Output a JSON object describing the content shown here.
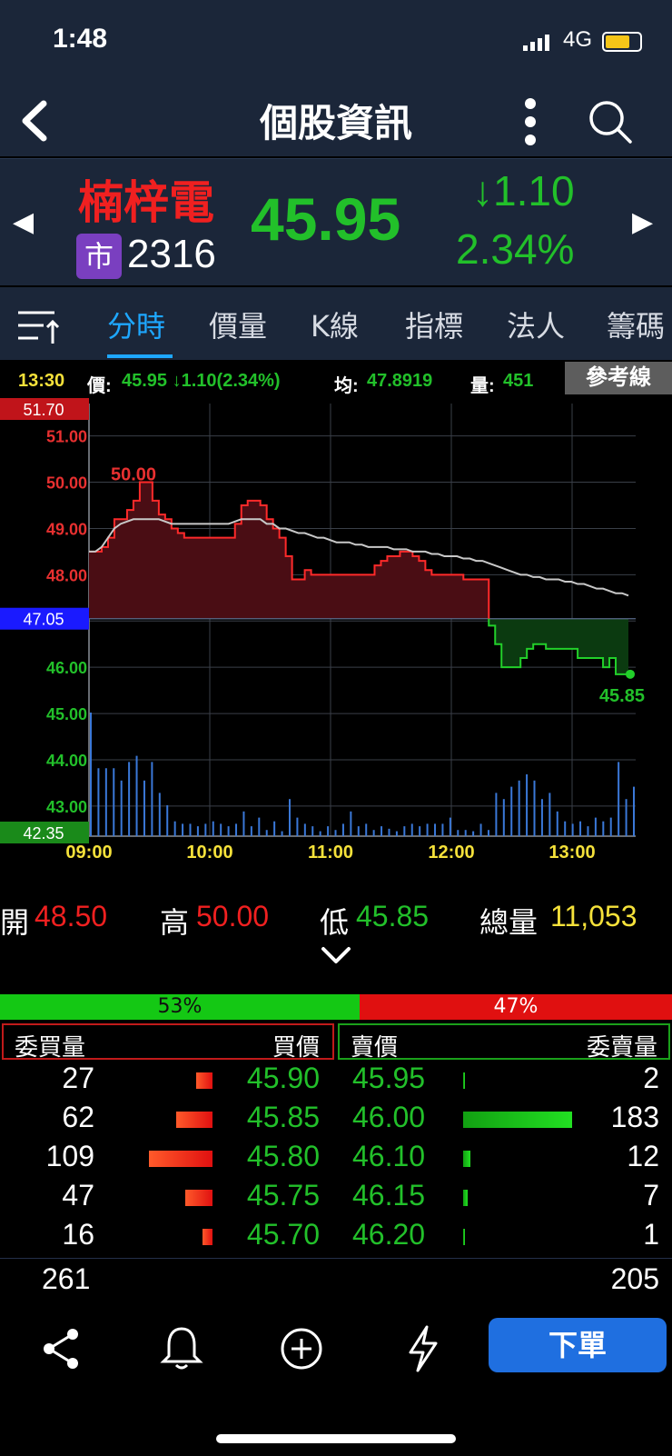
{
  "status": {
    "time": "1:48",
    "network": "4G"
  },
  "header": {
    "title": "個股資訊"
  },
  "stock": {
    "name": "楠梓電",
    "market_badge": "市",
    "code": "2316",
    "price": "45.95",
    "change": "↓1.10",
    "change_pct": "2.34%"
  },
  "tabs": [
    "分時",
    "價量",
    "K線",
    "指標",
    "法人",
    "籌碼"
  ],
  "info": {
    "time": "13:30",
    "price_label": "價:",
    "price": "45.95 ↓1.10(2.34%)",
    "avg_label": "均:",
    "avg": "47.8919",
    "vol_label": "量:",
    "vol": "451",
    "ref_button": "參考線"
  },
  "chart_data": {
    "type": "line",
    "y_labels_red": [
      "51.00",
      "50.00",
      "49.00",
      "48.00"
    ],
    "y_labels_green": [
      "46.00",
      "45.00",
      "44.00",
      "43.00"
    ],
    "y_top": "51.70",
    "y_ref": "47.05",
    "y_bottom": "42.35",
    "x_ticks": [
      "09:00",
      "10:00",
      "11:00",
      "12:00",
      "13:00"
    ],
    "ylim": [
      42.35,
      51.7
    ],
    "reference": 47.05,
    "high_label": "50.00",
    "last_label": "45.85",
    "price": [
      48.5,
      48.5,
      48.6,
      48.8,
      49.2,
      49.2,
      49.4,
      49.6,
      50.0,
      50.0,
      49.6,
      49.3,
      49.2,
      49.0,
      48.9,
      48.8,
      48.8,
      48.8,
      48.8,
      48.8,
      48.8,
      48.8,
      48.8,
      49.1,
      49.5,
      49.6,
      49.6,
      49.5,
      49.2,
      49.0,
      48.8,
      48.4,
      47.9,
      47.9,
      48.1,
      48.0,
      48.0,
      48.0,
      48.0,
      48.0,
      48.0,
      48.0,
      48.0,
      48.0,
      48.0,
      48.2,
      48.3,
      48.4,
      48.4,
      48.5,
      48.5,
      48.4,
      48.3,
      48.1,
      48.0,
      48.0,
      48.0,
      48.0,
      48.0,
      47.9,
      47.9,
      47.9,
      47.9,
      46.9,
      46.5,
      46.0,
      46.0,
      46.0,
      46.2,
      46.4,
      46.5,
      46.5,
      46.4,
      46.4,
      46.4,
      46.4,
      46.4,
      46.2,
      46.2,
      46.2,
      46.2,
      46.0,
      46.2,
      45.85,
      45.85,
      45.85
    ],
    "avg": [
      48.5,
      48.5,
      48.6,
      48.8,
      49.0,
      49.1,
      49.15,
      49.2,
      49.2,
      49.2,
      49.2,
      49.2,
      49.15,
      49.1,
      49.1,
      49.1,
      49.1,
      49.1,
      49.1,
      49.1,
      49.1,
      49.1,
      49.1,
      49.15,
      49.2,
      49.2,
      49.2,
      49.2,
      49.1,
      49.1,
      49.0,
      49.0,
      48.95,
      48.9,
      48.9,
      48.85,
      48.8,
      48.8,
      48.75,
      48.7,
      48.7,
      48.7,
      48.65,
      48.65,
      48.6,
      48.6,
      48.6,
      48.6,
      48.55,
      48.55,
      48.55,
      48.5,
      48.5,
      48.5,
      48.45,
      48.45,
      48.4,
      48.4,
      48.4,
      48.35,
      48.35,
      48.3,
      48.3,
      48.25,
      48.2,
      48.15,
      48.1,
      48.05,
      48.0,
      48.0,
      47.95,
      47.95,
      47.9,
      47.9,
      47.9,
      47.85,
      47.85,
      47.8,
      47.8,
      47.75,
      47.7,
      47.7,
      47.65,
      47.6,
      47.6,
      47.55
    ],
    "volume": [
      1.0,
      0.55,
      0.55,
      0.55,
      0.45,
      0.6,
      0.65,
      0.45,
      0.6,
      0.35,
      0.25,
      0.12,
      0.1,
      0.1,
      0.08,
      0.1,
      0.12,
      0.1,
      0.08,
      0.1,
      0.2,
      0.08,
      0.15,
      0.05,
      0.12,
      0.04,
      0.3,
      0.15,
      0.1,
      0.08,
      0.04,
      0.08,
      0.05,
      0.1,
      0.2,
      0.08,
      0.1,
      0.05,
      0.08,
      0.06,
      0.04,
      0.08,
      0.1,
      0.08,
      0.1,
      0.1,
      0.1,
      0.15,
      0.05,
      0.05,
      0.04,
      0.1,
      0.05,
      0.35,
      0.3,
      0.4,
      0.45,
      0.5,
      0.45,
      0.3,
      0.35,
      0.2,
      0.12,
      0.1,
      0.12,
      0.08,
      0.15,
      0.12,
      0.15,
      0.6,
      0.3,
      0.4
    ]
  },
  "stats": {
    "open_label": "開",
    "open": "48.50",
    "high_label": "高",
    "high": "50.00",
    "low_label": "低",
    "low": "45.85",
    "vol_label": "總量",
    "vol": "11,053"
  },
  "ratio": {
    "buy": "53%",
    "sell": "47%"
  },
  "book": {
    "headers": {
      "bid_qty": "委買量",
      "bid_price": "買價",
      "ask_price": "賣價",
      "ask_qty": "委賣量"
    },
    "rows": [
      {
        "bq": "27",
        "bp": "45.90",
        "ap": "45.95",
        "aq": "2",
        "bw": 0.25,
        "aw": 0.01
      },
      {
        "bq": "62",
        "bp": "45.85",
        "ap": "46.00",
        "aq": "183",
        "bw": 0.57,
        "aw": 1.0
      },
      {
        "bq": "109",
        "bp": "45.80",
        "ap": "46.10",
        "aq": "12",
        "bw": 1.0,
        "aw": 0.066
      },
      {
        "bq": "47",
        "bp": "45.75",
        "ap": "46.15",
        "aq": "7",
        "bw": 0.43,
        "aw": 0.04
      },
      {
        "bq": "16",
        "bp": "45.70",
        "ap": "46.20",
        "aq": "1",
        "bw": 0.15,
        "aw": 0.005
      }
    ],
    "total_bid": "261",
    "total_ask": "205"
  },
  "bottom": {
    "order_label": "下單"
  },
  "colors": {
    "up": "#f02020",
    "down": "#22c02a",
    "accent": "#1ea7ff"
  }
}
